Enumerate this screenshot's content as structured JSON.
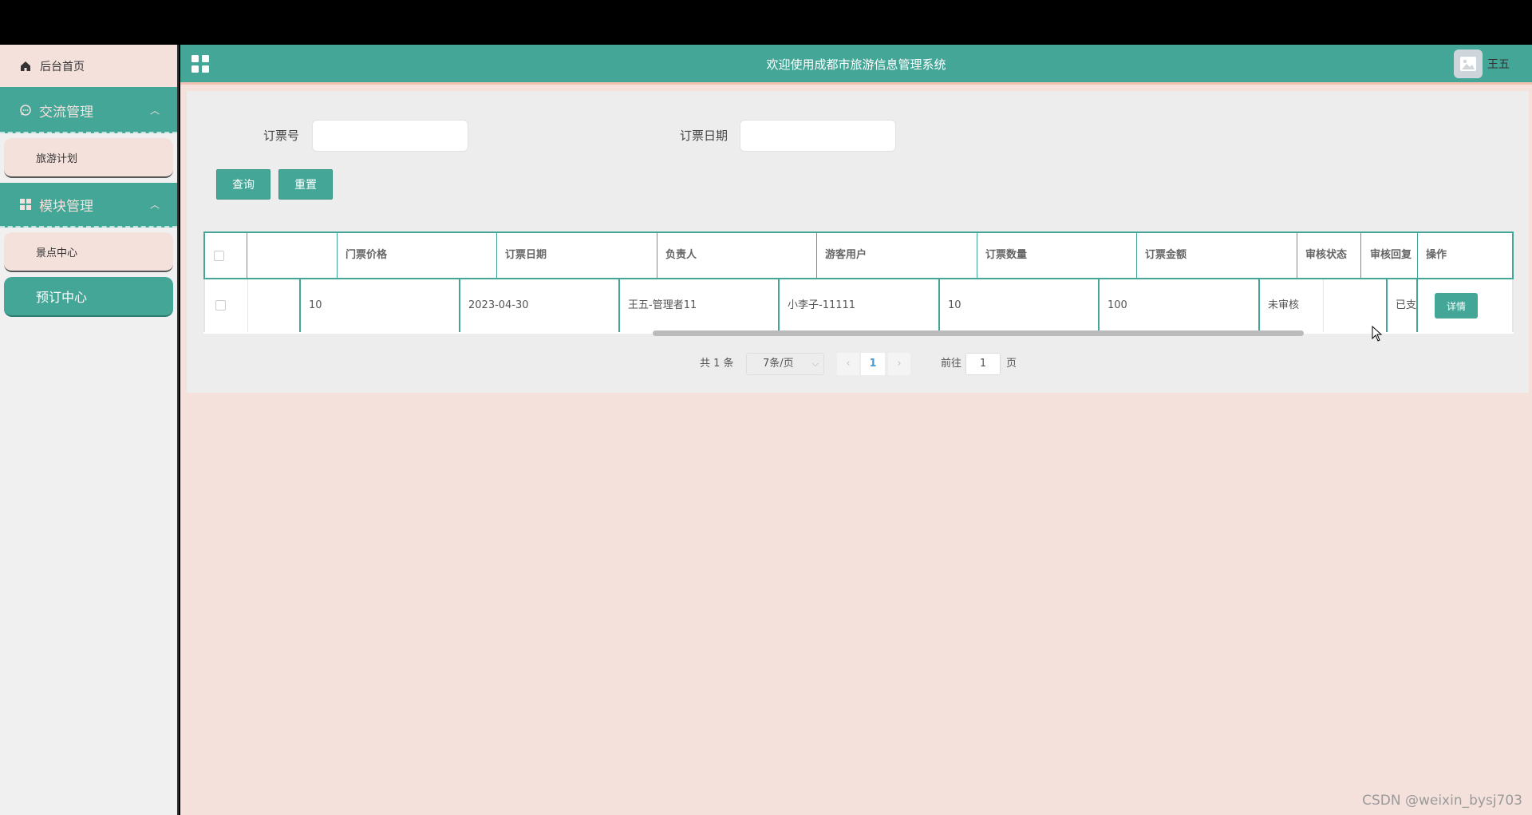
{
  "sidebar": {
    "home_label": "后台首页",
    "groups": [
      {
        "label": "交流管理",
        "items": [
          "旅游计划"
        ]
      },
      {
        "label": "模块管理",
        "items": [
          "景点中心",
          "预订中心"
        ]
      }
    ]
  },
  "header": {
    "title": "欢迎使用成都市旅游信息管理系统",
    "username": "王五"
  },
  "search": {
    "field1_label": "订票号",
    "field1_value": "",
    "field2_label": "订票日期",
    "field2_value": "",
    "query_button": "查询",
    "reset_button": "重置"
  },
  "table": {
    "columns": [
      "",
      "门票价格",
      "订票日期",
      "负责人",
      "游客用户",
      "订票数量",
      "订票金额",
      "审核状态",
      "审核回复",
      "操作"
    ],
    "rows": [
      {
        "c1": "",
        "price": "10",
        "date": "2023-04-30",
        "manager": "王五-管理者11",
        "user": "小李子-11111",
        "quantity": "10",
        "amount": "100",
        "review_status": "未审核",
        "review_reply": "",
        "payment": "已支",
        "action": "详情"
      }
    ]
  },
  "pagination": {
    "total": "共 1 条",
    "page_size": "7条/页",
    "current_page": "1",
    "goto_label": "前往",
    "goto_value": "1",
    "page_suffix": "页",
    "prev": "‹",
    "next": "›"
  },
  "watermark": "CSDN @weixin_bysj703",
  "colors": {
    "accent": "#43a697",
    "pink_bg": "#f5e1dc",
    "panel_bg": "#ededed"
  }
}
